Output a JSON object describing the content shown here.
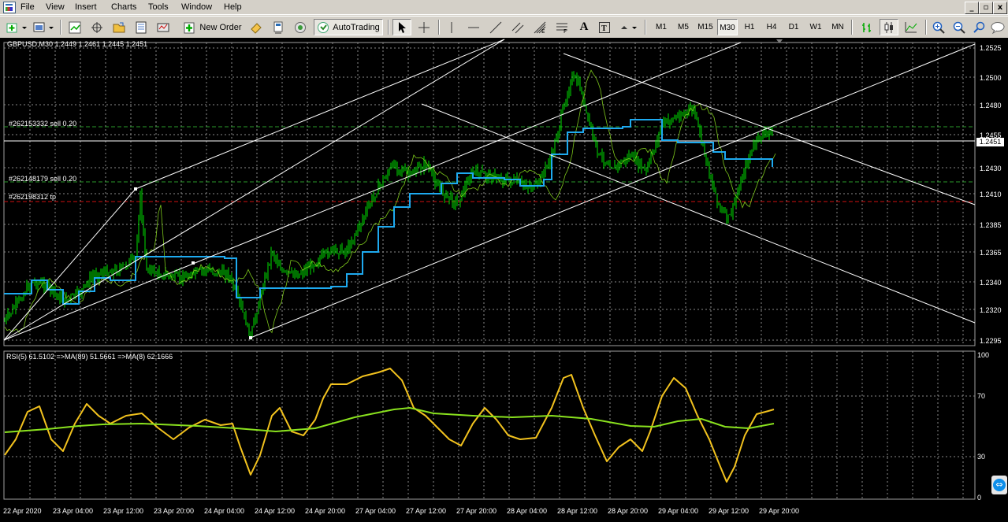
{
  "menubar": {
    "items": [
      {
        "label": "File"
      },
      {
        "label": "View"
      },
      {
        "label": "Insert"
      },
      {
        "label": "Charts"
      },
      {
        "label": "Tools"
      },
      {
        "label": "Window"
      },
      {
        "label": "Help"
      }
    ]
  },
  "window_controls": [
    "_",
    "▫",
    "x"
  ],
  "toolbar": {
    "new_order_label": "New Order",
    "autotrading_label": "AutoTrading",
    "timeframes": [
      "M1",
      "M5",
      "M15",
      "M30",
      "H1",
      "H4",
      "D1",
      "W1",
      "MN"
    ],
    "active_timeframe": "M30"
  },
  "chart": {
    "symbol_info": "GBPUSD,M30  1.2449 1.2461 1.2445 1.2451",
    "current_price": "1.2451",
    "price_ticks": [
      "1.2525",
      "1.2500",
      "1.2480",
      "1.2455",
      "1.2430",
      "1.2410",
      "1.2385",
      "1.2365",
      "1.2340",
      "1.2320",
      "1.2295"
    ],
    "orders": [
      {
        "label": "#262153332 sell 0.20"
      },
      {
        "label": "#262148179 sell 0.20"
      },
      {
        "label": "#262198312 tp"
      }
    ],
    "rsi_label": "RSI(5) 61.5102  =>MA(89) 51.5661  =>MA(8) 62.1666",
    "rsi_ticks": [
      "100",
      "70",
      "30",
      "0"
    ],
    "time_ticks": [
      "22 Apr 2020",
      "23 Apr 04:00",
      "23 Apr 12:00",
      "23 Apr 20:00",
      "24 Apr 04:00",
      "24 Apr 12:00",
      "24 Apr 20:00",
      "27 Apr 04:00",
      "27 Apr 12:00",
      "27 Apr 20:00",
      "28 Apr 04:00",
      "28 Apr 12:00",
      "28 Apr 20:00",
      "29 Apr 04:00",
      "29 Apr 12:00",
      "29 Apr 20:00"
    ],
    "colors": {
      "background": "#000000",
      "candles": "#00e000",
      "ma_line": "#1eaaf0",
      "thin_line": "#8adc1e",
      "channel": "#ffffff",
      "order_line": "#2a9a2a",
      "tp_line": "#d01010",
      "rsi": "#f2c21e",
      "rsi_ma": "#8ae21e",
      "grid": "#8a8a8a"
    }
  }
}
